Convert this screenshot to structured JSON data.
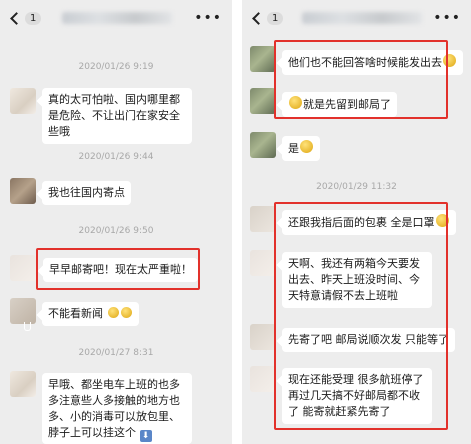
{
  "left": {
    "topbar": {
      "badge": "1"
    },
    "messages": [
      {
        "timestamp": "2020/01/26 9:19",
        "text": "真的太可怕啦、国内哪里都是危险、不让出门在家安全些哦"
      },
      {
        "timestamp": "2020/01/26 9:44",
        "text": "我也往国内寄点"
      },
      {
        "timestamp": "2020/01/26 9:50",
        "text": "早早邮寄吧！现在太严重啦！"
      },
      {
        "timestamp": "",
        "text": "不能看新闻"
      },
      {
        "timestamp": "2020/01/27 8:31",
        "text": "早哦、都坐电车上班的也多多注意些人多接触的地方也多、小的消毒可以放包里、脖子上可以挂这个"
      }
    ]
  },
  "right": {
    "topbar": {
      "badge": "1"
    },
    "messages": [
      {
        "text": "他们也不能回答啥时候能发出去"
      },
      {
        "text": "就是先留到邮局了"
      },
      {
        "text": "是"
      },
      {
        "timestamp": "2020/01/29 11:32",
        "text": "还跟我指后面的包裹 全是口罩"
      },
      {
        "text": "天啊、我还有两箱今天要发出去、昨天上班没时间、今天特意请假不去上班啦"
      },
      {
        "text": "先寄了吧 邮局说顺次发 只能等了"
      },
      {
        "text": "现在还能受理 很多航班停了 再过几天搞不好邮局都不收了 能寄就赶紧先寄了"
      }
    ]
  },
  "colors": {
    "chat_background": "#ededed",
    "bubble_background": "#ffffff",
    "highlight_border": "#e2312b",
    "timestamp": "#a8a8a8"
  }
}
